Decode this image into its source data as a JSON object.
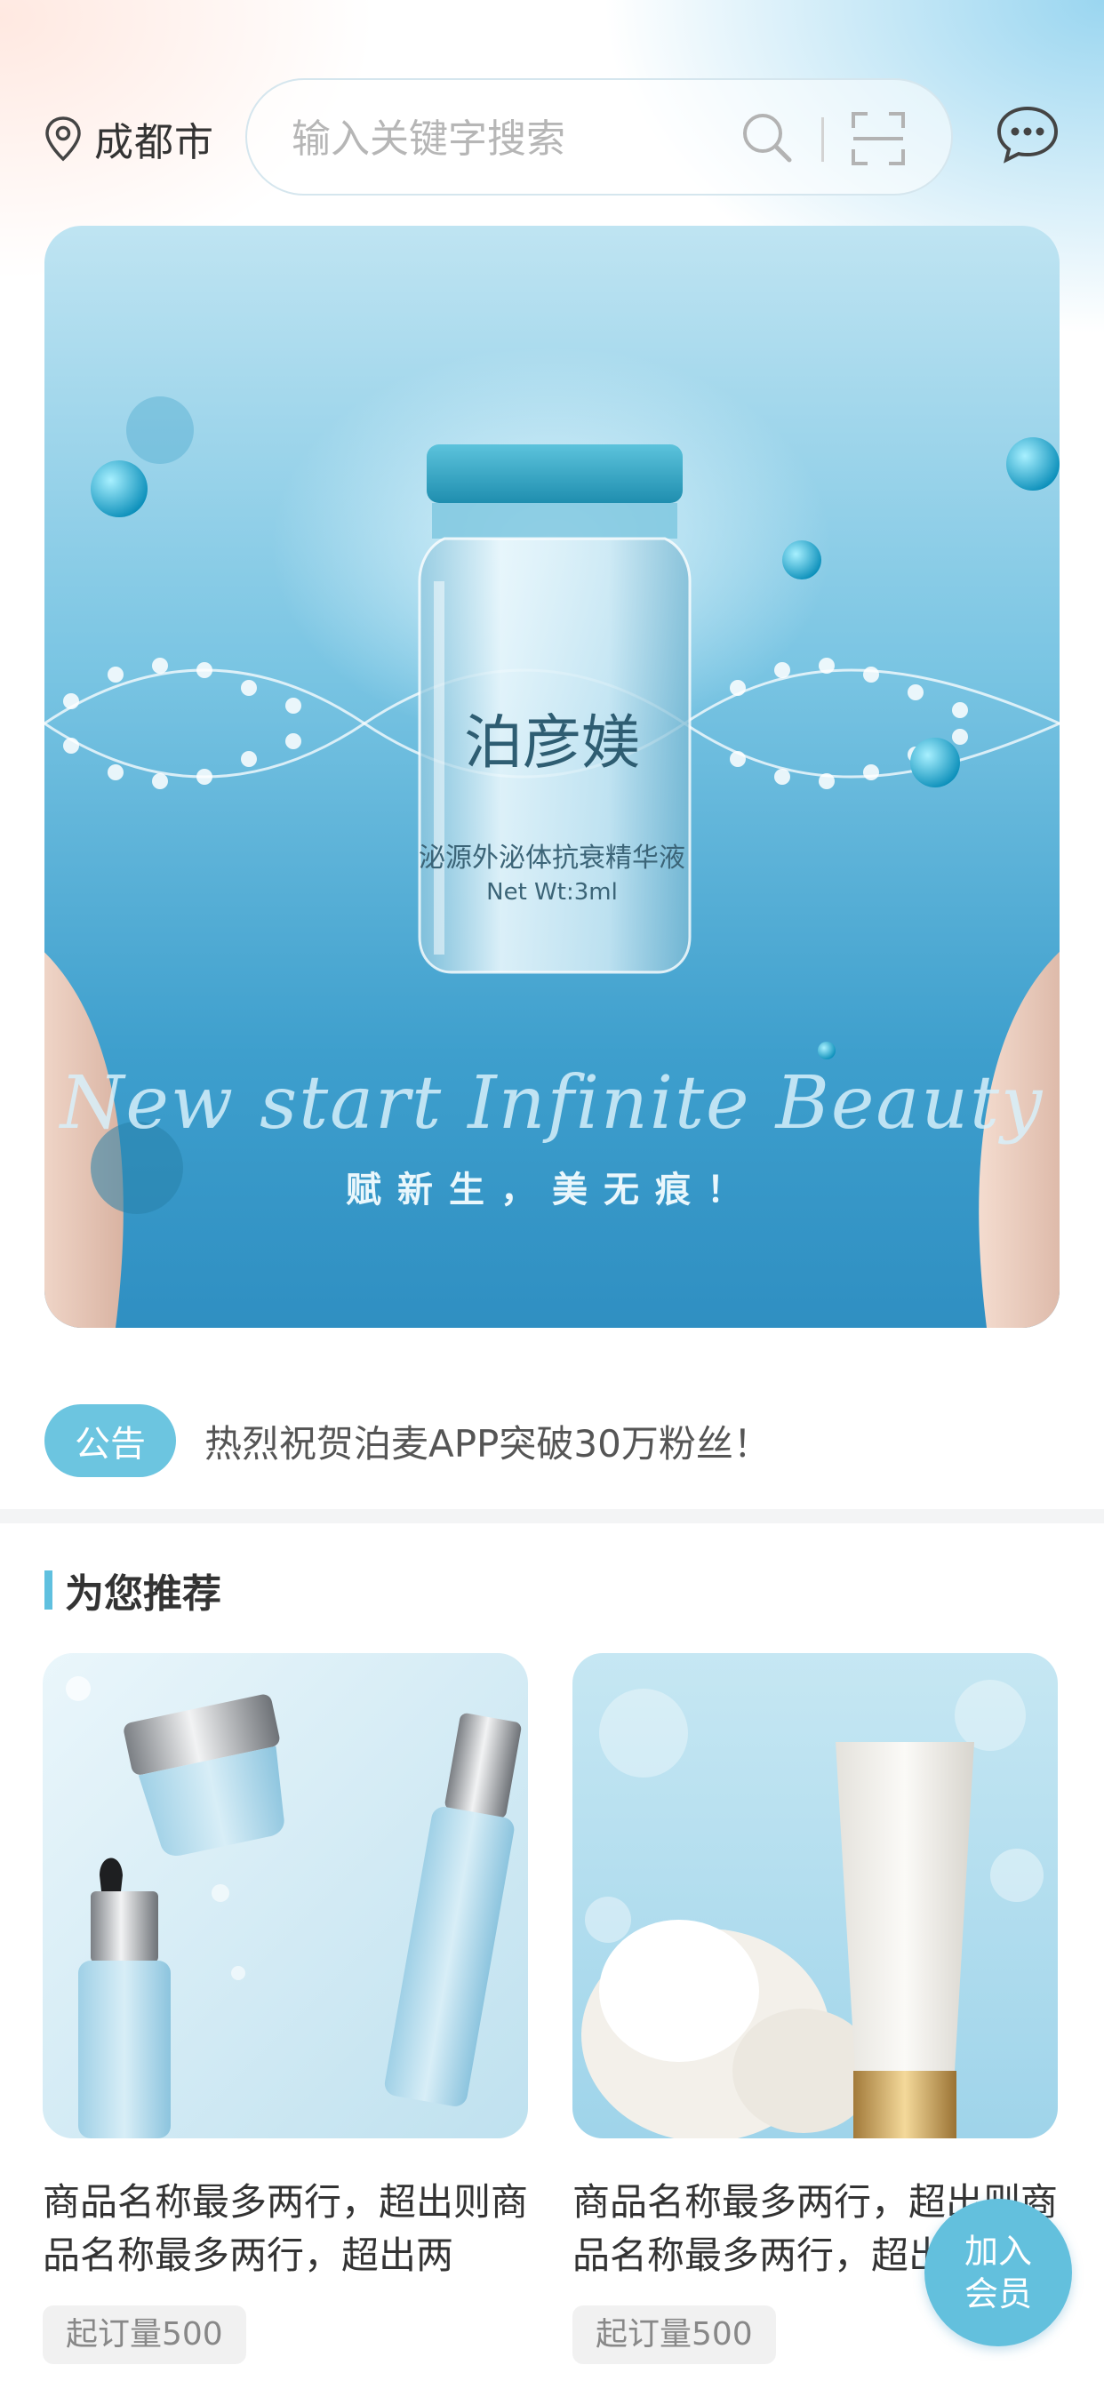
{
  "header": {
    "location": "成都市",
    "search_placeholder": "输入关键字搜索"
  },
  "banner": {
    "product_name": "泊彦媄",
    "product_desc": "泌源外泌体抗衰精华液",
    "product_weight": "Net Wt:3ml",
    "script_text": "New start Infinite Beauty",
    "slogan": "赋新生，美无痕！"
  },
  "notice": {
    "badge": "公告",
    "text": "热烈祝贺泊麦APP突破30万粉丝！"
  },
  "recommend": {
    "title": "为您推荐",
    "products": [
      {
        "name": "商品名称最多两行，超出则商品名称最多两行，超出两",
        "min_order": "起订量500"
      },
      {
        "name": "商品名称最多两行，超出则商品名称最多两行，超出两",
        "min_order": "起订量500"
      }
    ]
  },
  "join_button": {
    "line1": "加入",
    "line2": "会员"
  },
  "colors": {
    "accent": "#6cc5e0",
    "banner_blue": "#3e9fcd"
  },
  "icons": [
    "location-pin-icon",
    "search-icon",
    "scan-icon",
    "message-icon"
  ]
}
